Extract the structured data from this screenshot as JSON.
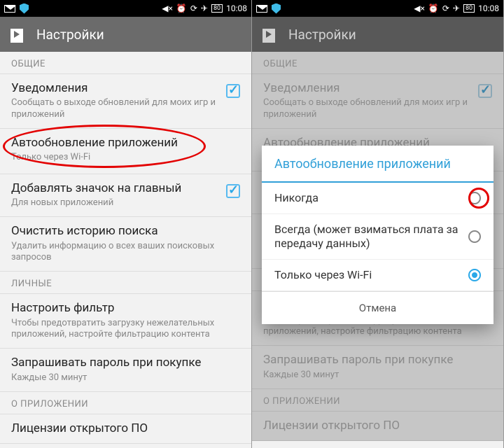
{
  "status": {
    "time": "10:08",
    "battery": "80",
    "icons": [
      "mute",
      "alarm",
      "sync",
      "airplane"
    ]
  },
  "actionbar": {
    "title": "Настройки"
  },
  "sections": {
    "general": "ОБЩИЕ",
    "personal": "ЛИЧНЫЕ",
    "about": "О ПРИЛОЖЕНИИ"
  },
  "rows": {
    "notifications": {
      "title": "Уведомления",
      "sub": "Сообщать о выходе обновлений для моих игр и приложений"
    },
    "autoupdate": {
      "title": "Автообновление приложений",
      "sub": "Только через Wi-Fi"
    },
    "addicon": {
      "title": "Добавлять значок на главный",
      "sub": "Для новых приложений"
    },
    "clearhistory": {
      "title": "Очистить историю поиска",
      "sub": "Удалить информацию о всех ваших поисковых запросов"
    },
    "filter": {
      "title": "Настроить фильтр",
      "sub": "Чтобы предотвратить загрузку нежелательных приложений, настройте фильтрацию контента"
    },
    "password": {
      "title": "Запрашивать пароль при покупке",
      "sub": "Каждые 30 минут"
    },
    "licenses": {
      "title": "Лицензии открытого ПО",
      "sub": ""
    }
  },
  "modal": {
    "title": "Автообновление приложений",
    "options": [
      "Никогда",
      "Всегда (может взиматься плата за передачу данных)",
      "Только через Wi-Fi"
    ],
    "selected_index": 2,
    "cancel": "Отмена"
  }
}
